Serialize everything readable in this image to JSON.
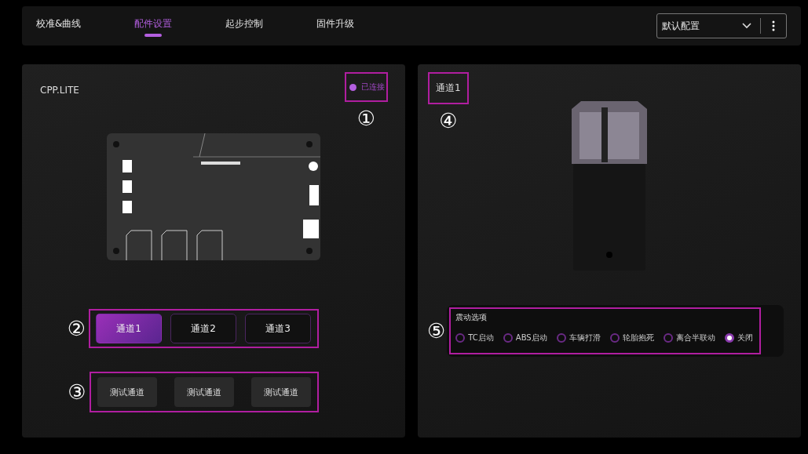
{
  "tabs": [
    {
      "label": "校准&曲线",
      "selected": false
    },
    {
      "label": "配件设置",
      "selected": true
    },
    {
      "label": "起步控制",
      "selected": false
    },
    {
      "label": "固件升级",
      "selected": false
    }
  ],
  "profile_select": {
    "value": "默认配置"
  },
  "device": {
    "name": "CPP.LITE",
    "status": "已连接",
    "annotation": "①"
  },
  "channel_buttons": {
    "annotation": "②",
    "items": [
      {
        "label": "通道1",
        "selected": true
      },
      {
        "label": "通道2",
        "selected": false
      },
      {
        "label": "通道3",
        "selected": false
      }
    ]
  },
  "test_buttons": {
    "annotation": "③",
    "items": [
      "测试通道",
      "测试通道",
      "测试通道"
    ]
  },
  "channel_detail": {
    "title": "通道1",
    "annotation": "④"
  },
  "vibration": {
    "annotation": "⑤",
    "title": "震动选项",
    "options": [
      {
        "label": "TC启动",
        "selected": false
      },
      {
        "label": "ABS启动",
        "selected": false
      },
      {
        "label": "车辆打滑",
        "selected": false
      },
      {
        "label": "轮胎抱死",
        "selected": false
      },
      {
        "label": "离合半联动",
        "selected": false
      },
      {
        "label": "关闭",
        "selected": true
      }
    ]
  }
}
